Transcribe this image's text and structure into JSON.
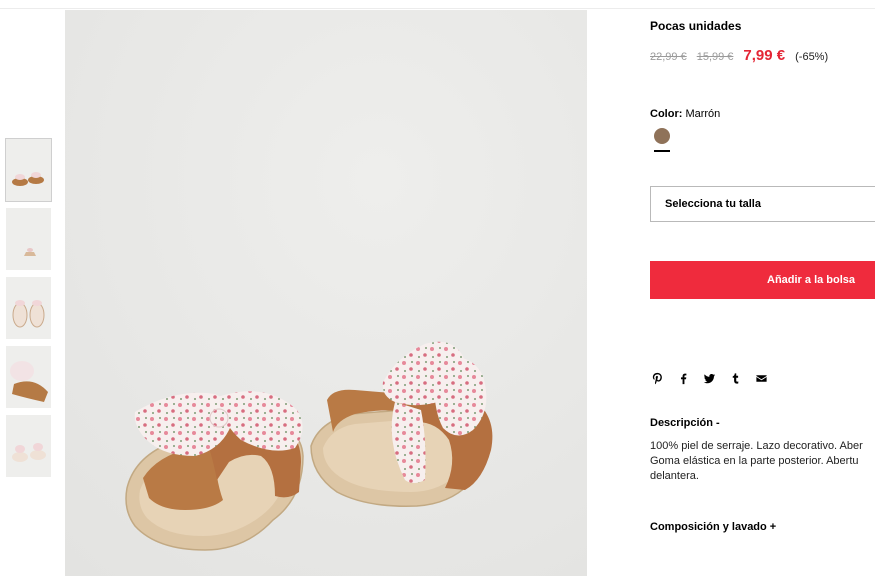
{
  "product": {
    "stock_label": "Pocas unidades",
    "old_price_1": "22,99 €",
    "old_price_2": "15,99 €",
    "price": "7,99 €",
    "discount": "(-65%)",
    "color_label": "Color:",
    "color_value": "Marrón",
    "swatch_color": "#8f7259"
  },
  "size_select": {
    "placeholder": "Selecciona tu talla"
  },
  "add_to_bag": {
    "label": "Añadir a la bolsa"
  },
  "share": {
    "icons": [
      "pinterest-icon",
      "facebook-icon",
      "twitter-icon",
      "tumblr-icon",
      "email-icon"
    ]
  },
  "description": {
    "title": "Descripción -",
    "lines": [
      "100% piel de serraje. Lazo decorativo. Aber",
      "Goma elástica en la parte posterior. Abertu",
      "delantera."
    ]
  },
  "composition": {
    "title": "Composición y lavado +"
  },
  "colors": {
    "accent": "#ef2b3d",
    "price_red": "#e42535"
  }
}
